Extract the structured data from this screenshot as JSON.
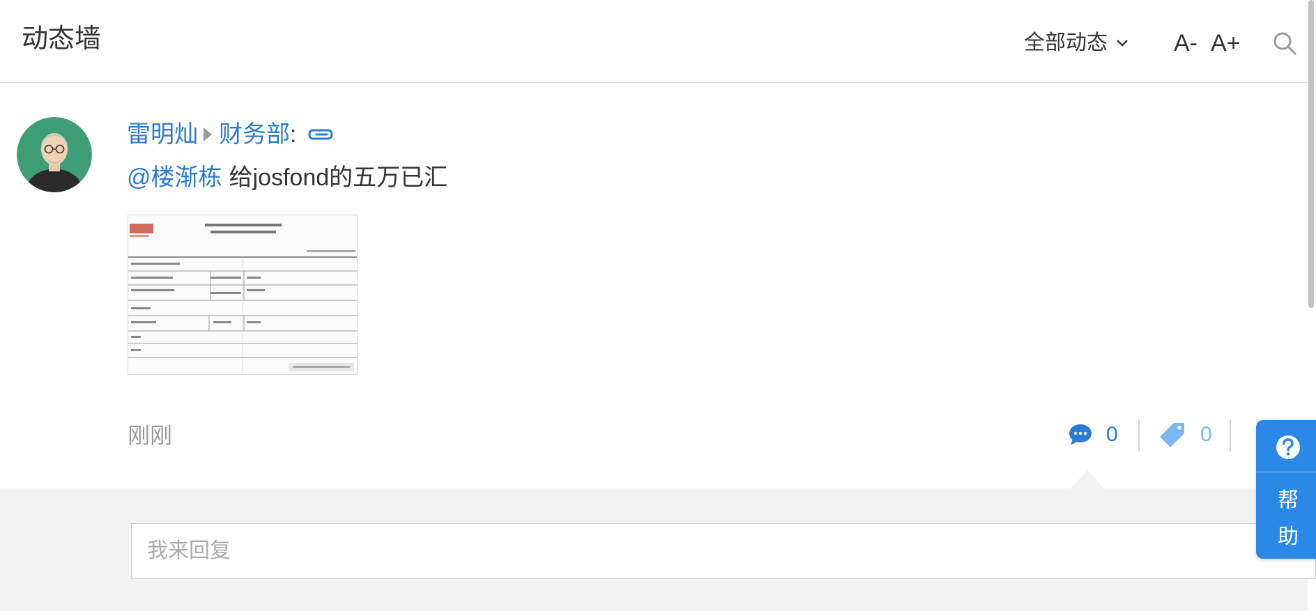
{
  "header": {
    "title": "动态墙",
    "filter_label": "全部动态",
    "font_decrease": "A-",
    "font_increase": "A+"
  },
  "post": {
    "author": "雷明灿",
    "department": "财务部",
    "colon": ":",
    "mention": "@楼渐栋",
    "text": "给josfond的五万已汇",
    "timestamp": "刚刚",
    "comment_count": "0",
    "tag_count": "0"
  },
  "reply": {
    "placeholder": "我来回复"
  },
  "help": {
    "label_1": "帮",
    "label_2": "助"
  },
  "colors": {
    "link": "#2a7bd4",
    "help_bg": "#2b88e6",
    "tag_icon": "#7ab6f0",
    "reply_bg": "#f2f2f2"
  },
  "icons": {
    "attachment": "paperclip-icon",
    "comment": "comment-bubble-icon",
    "tag": "tag-icon",
    "search": "search-icon",
    "dropdown": "chevron-down-icon",
    "help": "question-circle-icon"
  }
}
